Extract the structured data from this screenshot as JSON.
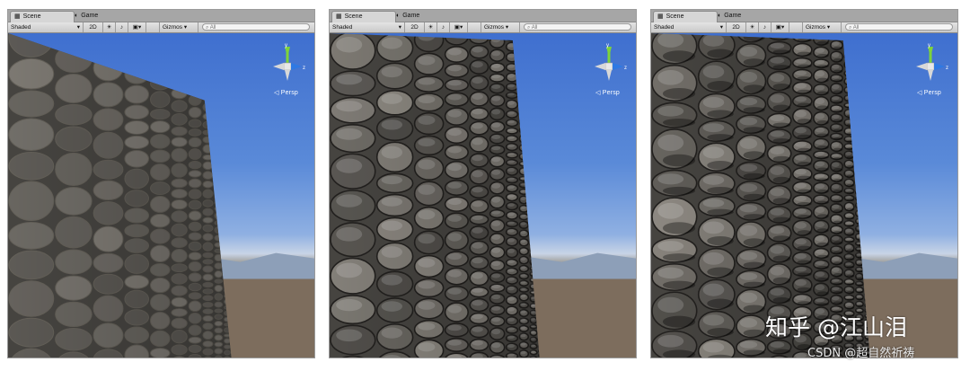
{
  "panels": [
    {
      "variant": "flat-texture",
      "tabs": {
        "scene": "Scene",
        "game": "Game"
      },
      "toolbar": {
        "draw_mode": "Shaded",
        "mode_2d": "2D",
        "gizmos": "Gizmos",
        "search_placeholder": "All"
      },
      "view_label": "Persp"
    },
    {
      "variant": "normal-map",
      "tabs": {
        "scene": "Scene",
        "game": "Game"
      },
      "toolbar": {
        "draw_mode": "Shaded",
        "mode_2d": "2D",
        "gizmos": "Gizmos",
        "search_placeholder": "All"
      },
      "view_label": "Persp"
    },
    {
      "variant": "parallax-map",
      "tabs": {
        "scene": "Scene",
        "game": "Game"
      },
      "toolbar": {
        "draw_mode": "Shaded",
        "mode_2d": "2D",
        "gizmos": "Gizmos",
        "search_placeholder": "All"
      },
      "view_label": "Persp"
    }
  ],
  "gizmo_axes": {
    "y": "y",
    "z": "z"
  },
  "colors": {
    "axis_y": "#7ed33a",
    "axis_z": "#2f79e3",
    "axis_x": "#d8d8d8"
  },
  "watermark": "知乎 @江山泪",
  "credit": "CSDN @超自然祈祷"
}
